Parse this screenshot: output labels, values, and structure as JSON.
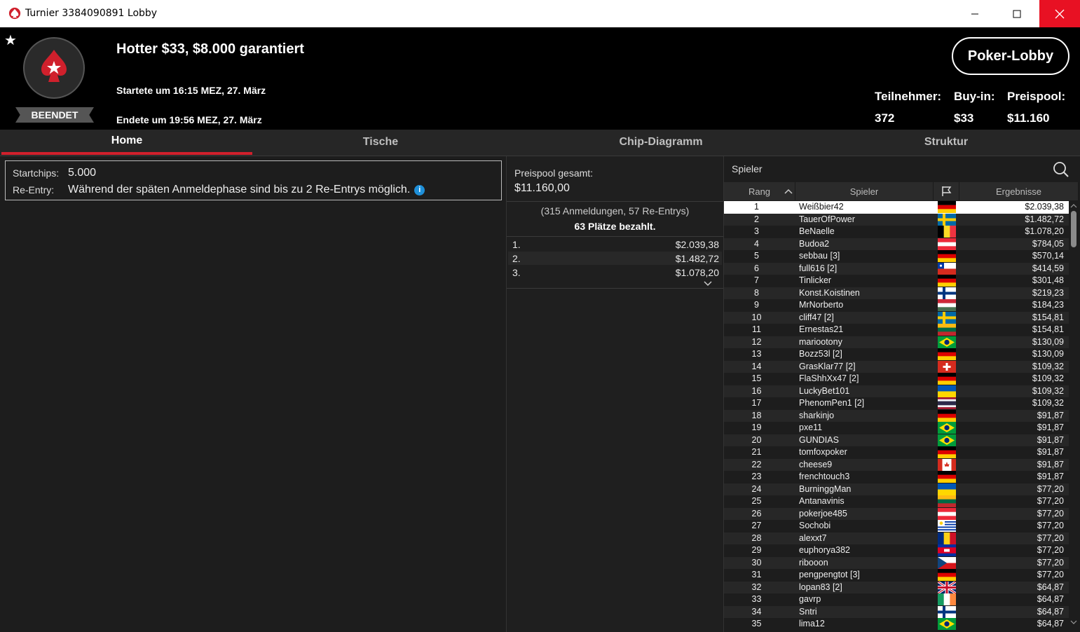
{
  "window": {
    "title": "Turnier 3384090891 Lobby"
  },
  "header": {
    "status_badge": "BEENDET",
    "tournament_name": "Hotter $33, $8.000 garantiert",
    "started": "Startete um 16:15 MEZ, 27. März",
    "ended": "Endete um 19:56 MEZ, 27. März",
    "lobby_button": "Poker-Lobby",
    "stats": {
      "participants_label": "Teilnehmer:",
      "participants_value": "372",
      "buyin_label": "Buy-in:",
      "buyin_value": "$33",
      "prizepool_label": "Preispool:",
      "prizepool_value": "$11.160"
    }
  },
  "tabs": [
    "Home",
    "Tische",
    "Chip-Diagramm",
    "Struktur"
  ],
  "info": {
    "startchips_label": "Startchips:",
    "startchips_value": "5.000",
    "reentry_label": "Re-Entry:",
    "reentry_value": "Während der späten Anmeldephase sind bis zu 2 Re-Entrys möglich."
  },
  "prizepool": {
    "label": "Preispool gesamt:",
    "value": "$11.160,00",
    "registrations": "(315 Anmeldungen, 57 Re-Entrys)",
    "paid": "63 Plätze bezahlt.",
    "places": [
      {
        "pos": "1.",
        "amount": "$2.039,38"
      },
      {
        "pos": "2.",
        "amount": "$1.482,72"
      },
      {
        "pos": "3.",
        "amount": "$1.078,20"
      }
    ]
  },
  "players": {
    "search_label": "Spieler",
    "columns": [
      "Rang",
      "Spieler",
      "Ergebnisse"
    ],
    "rows": [
      {
        "rank": "1",
        "name": "Weißbier42",
        "flag": "de",
        "prize": "$2.039,38"
      },
      {
        "rank": "2",
        "name": "TauerOfPower",
        "flag": "se",
        "prize": "$1.482,72"
      },
      {
        "rank": "3",
        "name": "BeNaelle",
        "flag": "be",
        "prize": "$1.078,20"
      },
      {
        "rank": "4",
        "name": "Budoa2",
        "flag": "at",
        "prize": "$784,05"
      },
      {
        "rank": "5",
        "name": "sebbau [3]",
        "flag": "de",
        "prize": "$570,14"
      },
      {
        "rank": "6",
        "name": "full616 [2]",
        "flag": "cl",
        "prize": "$414,59"
      },
      {
        "rank": "7",
        "name": "Tinlicker",
        "flag": "de",
        "prize": "$301,48"
      },
      {
        "rank": "8",
        "name": "Konst.Koistinen",
        "flag": "fi",
        "prize": "$219,23"
      },
      {
        "rank": "9",
        "name": "MrNorberto",
        "flag": "hu",
        "prize": "$184,23"
      },
      {
        "rank": "10",
        "name": "cliff47 [2]",
        "flag": "se",
        "prize": "$154,81"
      },
      {
        "rank": "11",
        "name": "Ernestas21",
        "flag": "lt",
        "prize": "$154,81"
      },
      {
        "rank": "12",
        "name": "mariootony",
        "flag": "br",
        "prize": "$130,09"
      },
      {
        "rank": "13",
        "name": "Bozz53l [2]",
        "flag": "de",
        "prize": "$130,09"
      },
      {
        "rank": "14",
        "name": "GrasKlar77 [2]",
        "flag": "ch",
        "prize": "$109,32"
      },
      {
        "rank": "15",
        "name": "FlaShhXx47 [2]",
        "flag": "de",
        "prize": "$109,32"
      },
      {
        "rank": "16",
        "name": "LuckyBet101",
        "flag": "ua",
        "prize": "$109,32"
      },
      {
        "rank": "17",
        "name": "PhenomPen1 [2]",
        "flag": "th",
        "prize": "$109,32"
      },
      {
        "rank": "18",
        "name": "sharkinjo",
        "flag": "de",
        "prize": "$91,87"
      },
      {
        "rank": "19",
        "name": "pxe11",
        "flag": "br",
        "prize": "$91,87"
      },
      {
        "rank": "20",
        "name": "GUNDIAS",
        "flag": "br",
        "prize": "$91,87"
      },
      {
        "rank": "21",
        "name": "tomfoxpoker",
        "flag": "de",
        "prize": "$91,87"
      },
      {
        "rank": "22",
        "name": "cheese9",
        "flag": "ca",
        "prize": "$91,87"
      },
      {
        "rank": "23",
        "name": "frenchtouch3",
        "flag": "de",
        "prize": "$91,87"
      },
      {
        "rank": "24",
        "name": "BurninggMan",
        "flag": "ua",
        "prize": "$77,20"
      },
      {
        "rank": "25",
        "name": "Antanavinis",
        "flag": "lt",
        "prize": "$77,20"
      },
      {
        "rank": "26",
        "name": "pokerjoe485",
        "flag": "at",
        "prize": "$77,20"
      },
      {
        "rank": "27",
        "name": "Sochobi",
        "flag": "uy",
        "prize": "$77,20"
      },
      {
        "rank": "28",
        "name": "alexxt7",
        "flag": "ro",
        "prize": "$77,20"
      },
      {
        "rank": "29",
        "name": "euphorya382",
        "flag": "kh",
        "prize": "$77,20"
      },
      {
        "rank": "30",
        "name": "riboоon",
        "flag": "cz",
        "prize": "$77,20"
      },
      {
        "rank": "31",
        "name": "pengpengtot [3]",
        "flag": "de",
        "prize": "$77,20"
      },
      {
        "rank": "32",
        "name": "lopan83 [2]",
        "flag": "gb",
        "prize": "$64,87"
      },
      {
        "rank": "33",
        "name": "gavrp",
        "flag": "ie",
        "prize": "$64,87"
      },
      {
        "rank": "34",
        "name": "Sntri",
        "flag": "fi",
        "prize": "$64,87"
      },
      {
        "rank": "35",
        "name": "lima12",
        "flag": "br",
        "prize": "$64,87"
      }
    ]
  },
  "colors": {
    "accent": "#d0202c",
    "info": "#1e8fd8"
  }
}
